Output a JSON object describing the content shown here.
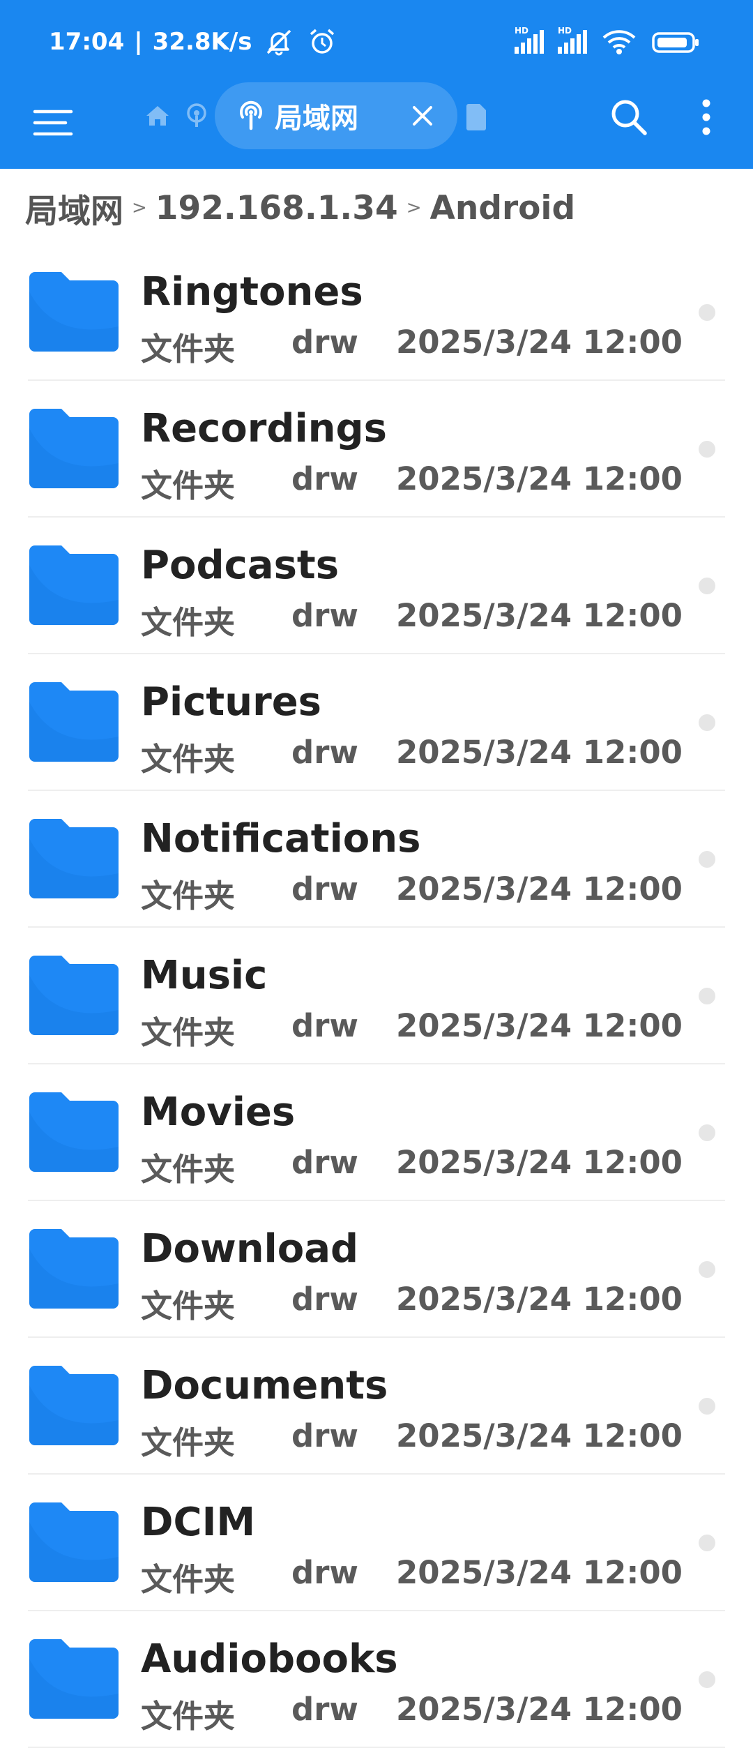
{
  "status": {
    "time": "17:04",
    "speed": "32.8K/s",
    "hd1": "HD",
    "hd2": "HD"
  },
  "toolbar": {
    "active_tab_label": "局域网"
  },
  "breadcrumb": {
    "items": [
      "局域网",
      "192.168.1.34",
      "Android"
    ],
    "separator": ">"
  },
  "files": [
    {
      "name": "Ringtones",
      "type": "文件夹",
      "perm": "drw",
      "date": "2025/3/24 12:00"
    },
    {
      "name": "Recordings",
      "type": "文件夹",
      "perm": "drw",
      "date": "2025/3/24 12:00"
    },
    {
      "name": "Podcasts",
      "type": "文件夹",
      "perm": "drw",
      "date": "2025/3/24 12:00"
    },
    {
      "name": "Pictures",
      "type": "文件夹",
      "perm": "drw",
      "date": "2025/3/24 12:00"
    },
    {
      "name": "Notifications",
      "type": "文件夹",
      "perm": "drw",
      "date": "2025/3/24 12:00"
    },
    {
      "name": "Music",
      "type": "文件夹",
      "perm": "drw",
      "date": "2025/3/24 12:00"
    },
    {
      "name": "Movies",
      "type": "文件夹",
      "perm": "drw",
      "date": "2025/3/24 12:00"
    },
    {
      "name": "Download",
      "type": "文件夹",
      "perm": "drw",
      "date": "2025/3/24 12:00"
    },
    {
      "name": "Documents",
      "type": "文件夹",
      "perm": "drw",
      "date": "2025/3/24 12:00"
    },
    {
      "name": "DCIM",
      "type": "文件夹",
      "perm": "drw",
      "date": "2025/3/24 12:00"
    },
    {
      "name": "Audiobooks",
      "type": "文件夹",
      "perm": "drw",
      "date": "2025/3/24 12:00"
    }
  ],
  "icons": {
    "menu": "menu-icon",
    "home": "home-icon",
    "lan": "lan-icon",
    "close": "close-icon",
    "doc": "document-icon",
    "search": "search-icon",
    "more": "more-vertical-icon",
    "folder": "folder-icon"
  },
  "colors": {
    "primary": "#1a87f0",
    "folder": "#1e88f5",
    "folder_dark": "#1477e0"
  }
}
